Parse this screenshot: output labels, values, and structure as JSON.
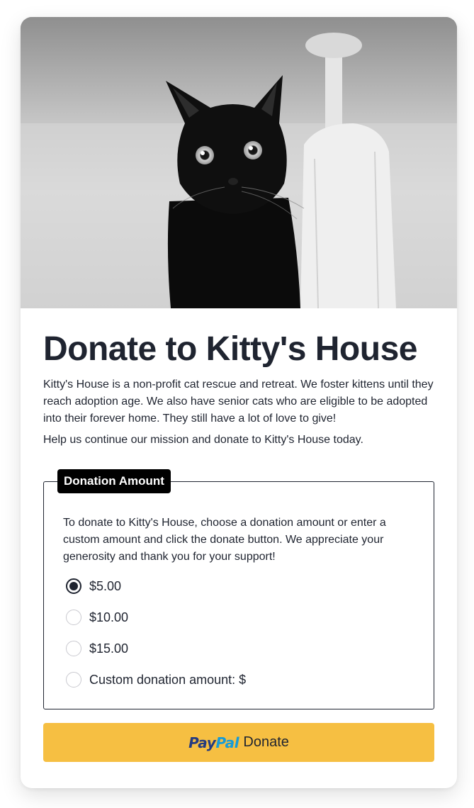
{
  "hero": {
    "image_subject": "black cat photo"
  },
  "page": {
    "title": "Donate to Kitty's House",
    "description": "Kitty's House is a non-profit cat rescue and retreat. We foster kittens until they reach adoption age. We also have senior cats who are eligible to be adopted into their forever home. They still have a lot of love to give!",
    "call_to_action": "Help us continue our mission and donate to Kitty's House today."
  },
  "donation": {
    "legend": "Donation Amount",
    "instructions": "To donate to Kitty's House, choose a donation amount or enter a custom amount and click the donate button. We appreciate your generosity and thank you for your support!",
    "options": [
      {
        "label": "$5.00",
        "checked": true
      },
      {
        "label": "$10.00",
        "checked": false
      },
      {
        "label": "$15.00",
        "checked": false
      },
      {
        "label": "Custom donation amount: $",
        "checked": false
      }
    ]
  },
  "button": {
    "logo_pay": "Pay",
    "logo_pal": "Pal",
    "label": "Donate"
  },
  "colors": {
    "button_bg": "#f6bf42",
    "text": "#1f2430",
    "legend_bg": "#000000",
    "paypal_dark": "#253b80",
    "paypal_light": "#179bd7"
  }
}
